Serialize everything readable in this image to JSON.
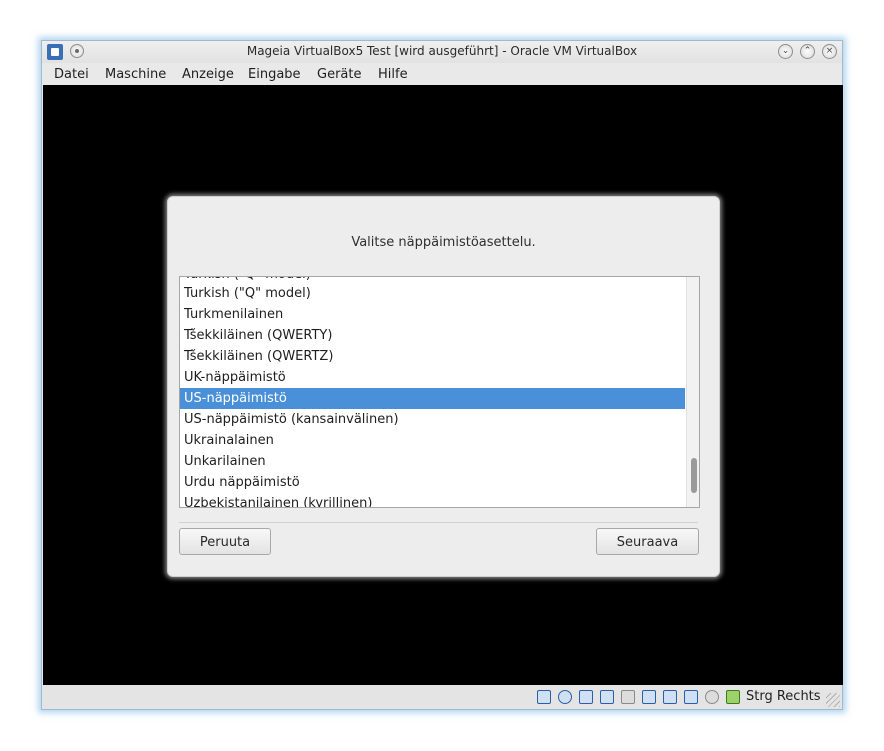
{
  "window": {
    "title": "Mageia VirtualBox5 Test [wird ausgeführt] - Oracle VM VirtualBox",
    "controls": [
      "minimize",
      "maximize",
      "close"
    ]
  },
  "menubar": {
    "items": [
      {
        "label": "Datei"
      },
      {
        "label": "Maschine"
      },
      {
        "label": "Anzeige"
      },
      {
        "label": "Eingabe"
      },
      {
        "label": "Geräte"
      },
      {
        "label": "Hilfe"
      }
    ]
  },
  "installer": {
    "prompt": "Valitse näppäimistöasettelu.",
    "layouts": [
      {
        "label": "Turkish (\"Q\" model)"
      },
      {
        "label": "Turkmenilainen"
      },
      {
        "label": "Tšekkiläinen (QWERTY)"
      },
      {
        "label": "Tšekkiläinen (QWERTZ)"
      },
      {
        "label": "UK-näppäimistö"
      },
      {
        "label": "US-näppäimistö"
      },
      {
        "label": "US-näppäimistö (kansainvälinen)"
      },
      {
        "label": "Ukrainalainen"
      },
      {
        "label": "Unkarilainen"
      },
      {
        "label": "Urdu näppäimistö"
      },
      {
        "label": "Uzbekistanilainen (kyrillinen)"
      }
    ],
    "selected_layout": "US-näppäimistö",
    "cancel_label": "Peruuta",
    "next_label": "Seuraava"
  },
  "statusbar": {
    "icons": [
      "hard-disk-icon",
      "optical-drive-icon",
      "audio-icon",
      "network-icon",
      "usb-icon",
      "shared-folders-icon",
      "display-icon",
      "video-capture-icon",
      "cpu-icon",
      "mouse-integration-icon",
      "keyboard-capture-icon"
    ],
    "host_key": "Strg Rechts"
  },
  "colors": {
    "selection": "#4a90d9",
    "vm_screen": "#000000"
  }
}
